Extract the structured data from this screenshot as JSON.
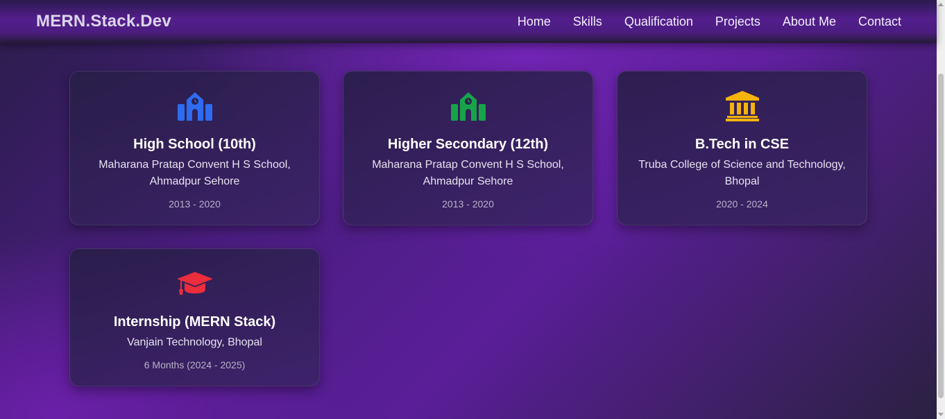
{
  "nav": {
    "brand": "MERN.Stack.Dev",
    "links": [
      "Home",
      "Skills",
      "Qualification",
      "Projects",
      "About Me",
      "Contact"
    ]
  },
  "qualifications": [
    {
      "icon": "school-icon",
      "icon_color": "#2d6cf0",
      "title": "High School (10th)",
      "place": "Maharana Pratap Convent H S School, Ahmadpur Sehore",
      "years": "2013 - 2020"
    },
    {
      "icon": "school-icon",
      "icon_color": "#17a34a",
      "title": "Higher Secondary (12th)",
      "place": "Maharana Pratap Convent H S School, Ahmadpur Sehore",
      "years": "2013 - 2020"
    },
    {
      "icon": "university-icon",
      "icon_color": "#f5b30c",
      "title": "B.Tech in CSE",
      "place": "Truba College of Science and Technology, Bhopal",
      "years": "2020 - 2024"
    },
    {
      "icon": "graduation-cap-icon",
      "icon_color": "#ec2d3c",
      "title": "Internship (MERN Stack)",
      "place": "Vanjain Technology, Bhopal",
      "years": "6 Months (2024 - 2025)"
    }
  ]
}
